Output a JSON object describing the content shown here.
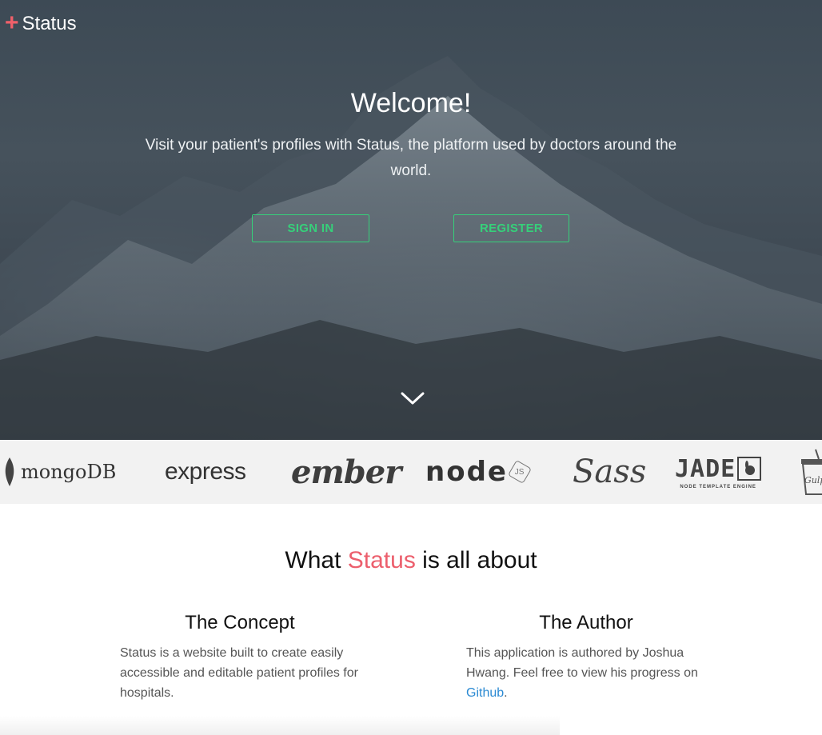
{
  "brand": {
    "icon": "plus-icon",
    "name": "Status",
    "accent": "#f0606a"
  },
  "hero": {
    "title": "Welcome!",
    "tagline": "Visit your patient's profiles with Status, the platform used by doctors around the world.",
    "buttons": {
      "signin": "SIGN IN",
      "register": "REGISTER"
    },
    "button_color": "#36d07a",
    "scroll_icon": "chevron-down-icon"
  },
  "tech_logos": {
    "mongo": "mongoDB",
    "express": "express",
    "ember": "ember",
    "node": "node",
    "node_badge": "JS",
    "sass": "Sass",
    "jade": "JADE",
    "jade_sub": "NODE TEMPLATE ENGINE",
    "gulp": "Gulp"
  },
  "about": {
    "title_before": "What ",
    "title_accent": "Status",
    "title_after": " is all about",
    "accent_color": "#ec5f6d",
    "concept": {
      "heading": "The Concept",
      "body": "Status is a website built to create easily accessible and editable patient profiles for hospitals."
    },
    "author": {
      "heading": "The Author",
      "body_before": "This application is authored by Joshua Hwang. Feel free to view his progress on ",
      "link": "Github",
      "body_after": "."
    }
  }
}
